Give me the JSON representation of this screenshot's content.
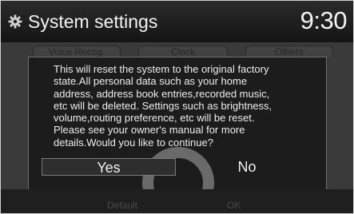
{
  "header": {
    "title": "System settings",
    "clock": "9:30",
    "icon": "gear-icon"
  },
  "tabs": [
    {
      "label": "Voice Recog."
    },
    {
      "label": "Clock"
    },
    {
      "label": "Others"
    }
  ],
  "dialog": {
    "message": "This will reset the system to the original factory\nstate.All personal data such as your home\naddress, address book entries,recorded music,\netc will be deleted. Settings such as brightness,\nvolume,routing preference, etc will be reset.\nPlease see your owner's manual for more\ndetails.Would you like to continue?",
    "yes_label": "Yes",
    "no_label": "No"
  },
  "footer": {
    "default_label": "Default",
    "ok_label": "OK"
  },
  "colors": {
    "background": "#3a3a3a",
    "dialog": "#1c1c1c",
    "text": "#ededed"
  }
}
